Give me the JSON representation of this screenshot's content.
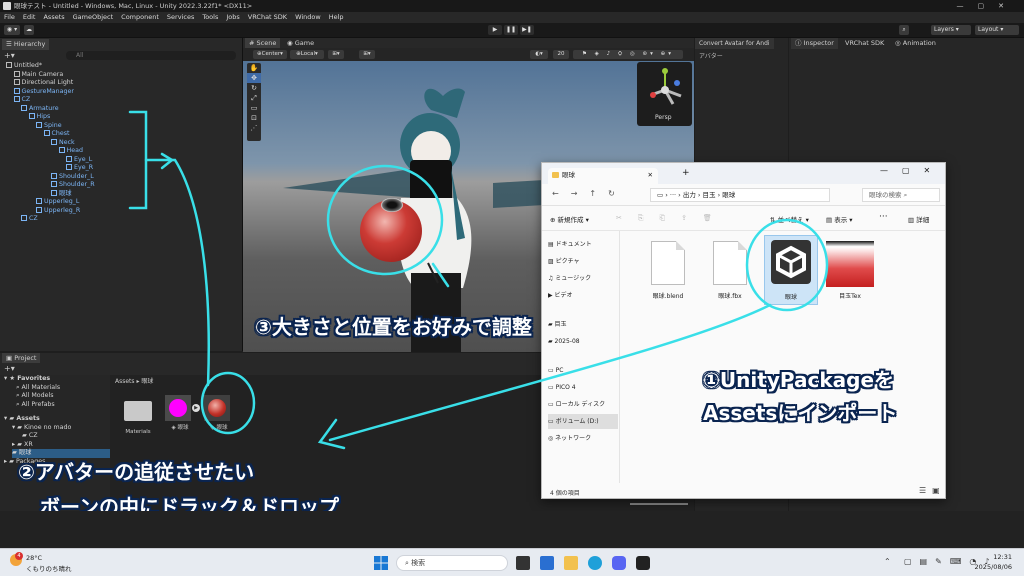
{
  "window": {
    "title": "眼球テスト - Untitled - Windows, Mac, Linux - Unity 2022.3.22f1* <DX11>"
  },
  "menu": [
    "File",
    "Edit",
    "Assets",
    "GameObject",
    "Component",
    "Services",
    "Tools",
    "Jobs",
    "VRChat SDK",
    "Window",
    "Help"
  ],
  "toolbar": {
    "layers": "Layers",
    "layout": "Layout"
  },
  "hierarchy": {
    "tab": "Hierarchy",
    "search_placeholder": "All",
    "items": [
      {
        "label": "Untitled*",
        "depth": 0,
        "blue": false
      },
      {
        "label": "Main Camera",
        "depth": 1,
        "blue": false
      },
      {
        "label": "Directional Light",
        "depth": 1,
        "blue": false
      },
      {
        "label": "GestureManager",
        "depth": 1,
        "blue": true
      },
      {
        "label": "CZ",
        "depth": 1,
        "blue": true
      },
      {
        "label": "Armature",
        "depth": 2,
        "blue": true
      },
      {
        "label": "Hips",
        "depth": 3,
        "blue": true
      },
      {
        "label": "Spine",
        "depth": 4,
        "blue": true
      },
      {
        "label": "Chest",
        "depth": 5,
        "blue": true
      },
      {
        "label": "Neck",
        "depth": 6,
        "blue": true
      },
      {
        "label": "Head",
        "depth": 7,
        "blue": true
      },
      {
        "label": "Eye_L",
        "depth": 8,
        "blue": true
      },
      {
        "label": "Eye_R",
        "depth": 8,
        "blue": true
      },
      {
        "label": "Shoulder_L",
        "depth": 6,
        "blue": true
      },
      {
        "label": "Shoulder_R",
        "depth": 6,
        "blue": true
      },
      {
        "label": "眼球",
        "depth": 6,
        "blue": true
      },
      {
        "label": "Upperleg_L",
        "depth": 4,
        "blue": true
      },
      {
        "label": "Upperleg_R",
        "depth": 4,
        "blue": true
      },
      {
        "label": "CZ",
        "depth": 2,
        "blue": true
      }
    ]
  },
  "scene": {
    "tab_scene": "Scene",
    "tab_game": "Game",
    "pivot": "Center",
    "space": "Local",
    "grid": "20",
    "persp": "Persp"
  },
  "convert_panel": {
    "tab": "Convert Avatar for Andi",
    "label": "アバター"
  },
  "inspector": {
    "tabs": [
      "Inspector",
      "VRChat SDK",
      "Animation"
    ]
  },
  "project": {
    "tab": "Project",
    "favorites": [
      "Favorites",
      "All Materials",
      "All Models",
      "All Prefabs"
    ],
    "assets_tree": [
      "Assets",
      "Kinoe no mado",
      "CZ",
      "XR",
      "眼球",
      "Packages"
    ],
    "breadcrumb": [
      "Assets",
      "眼球"
    ],
    "files": [
      {
        "name": "Materials"
      },
      {
        "name": "眼球"
      },
      {
        "name": "眼球"
      }
    ]
  },
  "explorer": {
    "title": "眼球",
    "path": [
      "出力",
      "目玉",
      "眼球"
    ],
    "search_placeholder": "眼球の検索",
    "new_label": "新規作成",
    "sort_label": "並べ替え",
    "view_label": "表示",
    "details_label": "詳細",
    "sidebar": [
      "ドキュメント",
      "ピクチャ",
      "ミュージック",
      "ビデオ",
      "目玉",
      "2025-08",
      "PC",
      "PICO 4",
      "ローカル ディスク",
      "ボリューム (D:)",
      "ネットワーク"
    ],
    "files": [
      {
        "name": "眼球.blend"
      },
      {
        "name": "眼球.fbx"
      },
      {
        "name": "眼球"
      },
      {
        "name": "目玉Tex"
      }
    ],
    "status": "4 個の項目"
  },
  "annotations": {
    "step1_line1": "①UnityPackageを",
    "step1_line2": "Assetsにインポート",
    "step2_line1": "②アバターの追従させたい",
    "step2_line2": "ボーンの中にドラック＆ドロップ",
    "step3": "③大きさと位置をお好みで調整"
  },
  "taskbar": {
    "weather_temp": "28°C",
    "weather_desc": "くもりのち晴れ",
    "weather_badge": "4",
    "search_placeholder": "検索",
    "time": "12:31",
    "date": "2025/08/06"
  },
  "colors": {
    "annotation_stroke": "#39dfe8",
    "annotation_text": "#ffffff",
    "annotation_outline": "#0a2450"
  }
}
